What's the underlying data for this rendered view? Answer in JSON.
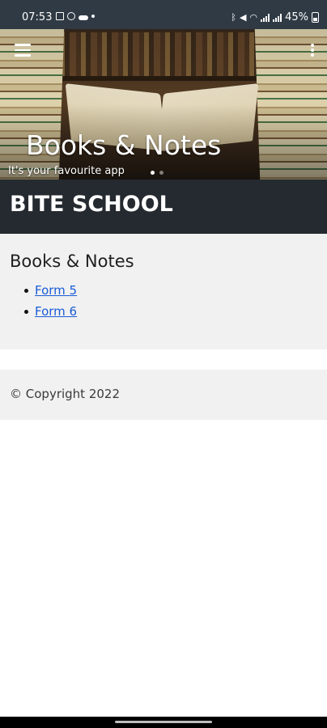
{
  "status_bar": {
    "time": "07:53",
    "battery": "45%",
    "left_icons": [
      "image-icon",
      "whatsapp-icon",
      "cloud-icon",
      "dot-icon"
    ],
    "right_icons": [
      "bluetooth-icon",
      "mute-icon",
      "wifi-icon",
      "signal-icon",
      "signal-icon",
      "battery-icon"
    ]
  },
  "hero": {
    "title": "Books & Notes",
    "subtitle": "It's your favourite app",
    "menu_icon": "hamburger-menu-icon",
    "overflow_icon": "overflow-menu-icon"
  },
  "site": {
    "title": "BITE SCHOOL"
  },
  "content": {
    "heading": "Books & Notes",
    "links": [
      {
        "label": "Form 5"
      },
      {
        "label": "Form 6"
      }
    ]
  },
  "footer": {
    "copyright": "© Copyright 2022"
  },
  "colors": {
    "status_bar": "#2f3a44",
    "site_band": "#252a30",
    "content_bg": "#f1f1f1",
    "link": "#1a5cd6"
  }
}
